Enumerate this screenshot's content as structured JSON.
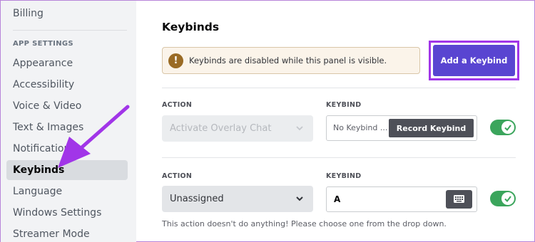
{
  "sidebar": {
    "items_top": [
      {
        "label": "Billing"
      }
    ],
    "section_header": "APP SETTINGS",
    "items": [
      {
        "label": "Appearance"
      },
      {
        "label": "Accessibility"
      },
      {
        "label": "Voice & Video"
      },
      {
        "label": "Text & Images"
      },
      {
        "label": "Notifications"
      },
      {
        "label": "Keybinds",
        "active": true
      },
      {
        "label": "Language"
      },
      {
        "label": "Windows Settings"
      },
      {
        "label": "Streamer Mode"
      }
    ]
  },
  "main": {
    "title": "Keybinds",
    "notice": {
      "icon": "!",
      "text": "Keybinds are disabled while this panel is visible."
    },
    "add_button_label": "Add a Keybind",
    "rows": [
      {
        "action_label": "ACTION",
        "action_value": "Activate Overlay Chat",
        "keybind_label": "KEYBIND",
        "keybind_placeholder": "No Keybind ...",
        "record_label": "Record Keybind",
        "enabled": true,
        "disabled_select": true
      },
      {
        "action_label": "ACTION",
        "action_value": "Unassigned",
        "keybind_label": "KEYBIND",
        "keybind_value": "A",
        "enabled": true,
        "help_text": "This action doesn't do anything! Please choose one from the drop down."
      }
    ]
  },
  "colors": {
    "accent": "#5945d1",
    "highlight": "#a135e8",
    "toggle_on": "#3ba55c",
    "warning_icon": "#9a6b25"
  },
  "icons": [
    "warning-icon",
    "chevron-down-icon",
    "keyboard-icon",
    "check-icon",
    "pointer-arrow-icon"
  ]
}
